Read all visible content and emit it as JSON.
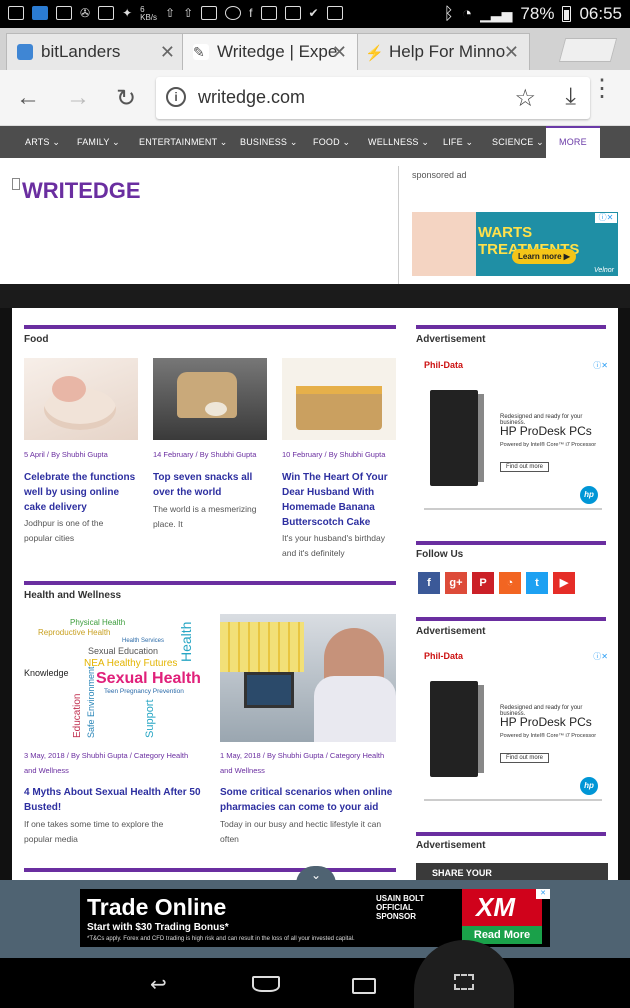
{
  "status_bar": {
    "kbs": "6\nKB/s",
    "battery": "78%",
    "time": "06:55"
  },
  "tabs": [
    {
      "label": "bitLanders",
      "fav_color": "#3f86d4"
    },
    {
      "label": "Writedge | Expe",
      "fav_color": "#777777"
    },
    {
      "label": "Help For Minno",
      "fav_color": "#444444"
    }
  ],
  "omnibox": {
    "url": "writedge.com"
  },
  "menu": [
    "ARTS",
    "FAMILY",
    "ENTERTAINMENT",
    "BUSINESS",
    "FOOD",
    "WELLNESS",
    "LIFE",
    "SCIENCE",
    "MORE"
  ],
  "site": {
    "logo": "WRITEDGE",
    "sponsored": "sponsored ad",
    "warts_ad": {
      "title": "WARTS TREATMENTS",
      "button": "Learn more",
      "brand": "Velnor"
    }
  },
  "food": {
    "title": "Food",
    "cards": [
      {
        "meta": "5 April / By Shubhi Gupta",
        "title": [
          "Celebrate the functions",
          "well by using online",
          "cake delivery"
        ],
        "excerpt": [
          "Jodhpur is one of the",
          "popular cities"
        ]
      },
      {
        "meta": "14 February / By Shubhi Gupta",
        "title": [
          "Top seven snacks all",
          "over the world"
        ],
        "excerpt": [
          "The world is a mesmerizing",
          "place. It"
        ]
      },
      {
        "meta": "10 February / By Shubhi Gupta",
        "title": [
          "Win The Heart Of Your",
          "Dear Husband With",
          "Homemade Banana",
          "Butterscotch Cake"
        ],
        "excerpt": [
          "It's your husband's birthday",
          "and it's definitely"
        ]
      }
    ]
  },
  "health": {
    "title": "Health and Wellness",
    "cards": [
      {
        "meta": [
          "3 May, 2018 / By Shubhi Gupta / Category Health",
          "and Wellness"
        ],
        "title": [
          "4 Myths About Sexual Health After 50",
          "Busted!"
        ],
        "excerpt": [
          "If one takes some time to explore the",
          "popular media"
        ]
      },
      {
        "meta": [
          "1 May, 2018 / By Shubhi Gupta / Category Health",
          "and Wellness"
        ],
        "title": [
          "Some critical scenarios when online",
          "pharmacies can come to your aid"
        ],
        "excerpt": [
          "Today in our busy and hectic lifestyle it can",
          "often"
        ]
      }
    ],
    "word_cloud": [
      "Physical Health",
      "Reproductive Health",
      "Health Services",
      "Sexual Education",
      "NEA Healthy Futures",
      "Knowledge",
      "Sexual Health",
      "Teen Pregnancy Prevention",
      "Education",
      "Safe Environment",
      "Support",
      "Health"
    ]
  },
  "sidebar": {
    "advertisement": "Advertisement",
    "follow_us": "Follow Us",
    "hp_ad": {
      "brand": "Phil-Data",
      "line1": "Redesigned and ready for your business.",
      "line2": "HP ProDesk PCs",
      "line3": "Powered by Intel® Core™ i7 Processor",
      "button": "Find out more",
      "logo": "hp"
    },
    "third_ad_text": "SHARE YOUR"
  },
  "social": [
    {
      "name": "facebook",
      "glyph": "f",
      "color": "#3b5998"
    },
    {
      "name": "google-plus",
      "glyph": "g+",
      "color": "#dd4b39"
    },
    {
      "name": "pinterest",
      "glyph": "P",
      "color": "#cb2027"
    },
    {
      "name": "rss",
      "glyph": "◔",
      "color": "#f26522"
    },
    {
      "name": "twitter",
      "glyph": "t",
      "color": "#1da1f2"
    },
    {
      "name": "youtube",
      "glyph": "▶",
      "color": "#e52d27"
    }
  ],
  "bottom_banner": {
    "title": "Trade Online",
    "subtitle": "Start with $30 Trading Bonus*",
    "disclaimer": "*T&Cs apply. Forex and CFD trading is high risk and can result in the loss of all your invested capital.",
    "sponsor": "USAIN BOLT OFFICIAL SPONSOR",
    "brand": "XM",
    "cta": "Read More"
  },
  "colors": {
    "accent": "#6a2ea0",
    "link": "#2d2fa0",
    "menu_bg": "#4d4d4d"
  }
}
